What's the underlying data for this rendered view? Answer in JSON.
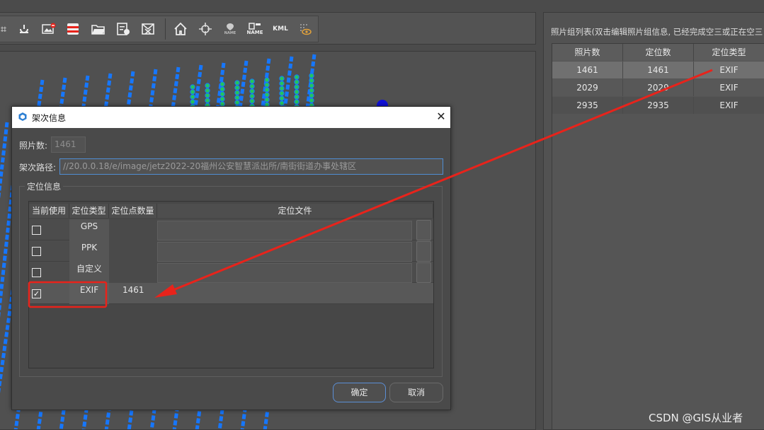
{
  "toolbar": {
    "icons": [
      "crop-icon",
      "stamp-icon",
      "image-remove-icon",
      "record-icon",
      "open-folder-icon",
      "report-icon",
      "mail-close-icon",
      "home-icon",
      "target-icon",
      "name-marker-icon",
      "name-tag-icon",
      "kml-icon",
      "visibility-icon"
    ],
    "name_text": "NAME",
    "name_text2": "NAME",
    "kml_text": "KML"
  },
  "right_panel": {
    "title": "照片组列表(双击编辑照片组信息, 已经完成空三或正在空三",
    "columns": [
      "照片数",
      "定位数",
      "定位类型"
    ],
    "rows": [
      [
        "1461",
        "1461",
        "EXIF"
      ],
      [
        "2029",
        "2029",
        "EXIF"
      ],
      [
        "2935",
        "2935",
        "EXIF"
      ]
    ],
    "selected_row": 0
  },
  "dialog": {
    "title": "架次信息",
    "photo_count_label": "照片数:",
    "photo_count_value": "1461",
    "path_label": "架次路径:",
    "path_value": "//20.0.0.18/e/image/jetz2022-20福州公安智慧派出所/南街街道办事处辖区",
    "group_label": "定位信息",
    "columns": [
      "当前使用",
      "定位类型",
      "定位点数量",
      "定位文件"
    ],
    "rows": [
      {
        "checked": false,
        "type": "GPS",
        "count": ""
      },
      {
        "checked": false,
        "type": "PPK",
        "count": ""
      },
      {
        "checked": false,
        "type": "自定义",
        "count": ""
      },
      {
        "checked": true,
        "type": "EXIF",
        "count": "1461"
      }
    ],
    "ok_label": "确定",
    "cancel_label": "取消"
  },
  "colors": {
    "annotation_red": "#e8231b",
    "point_blue": "#1677ff",
    "point_green": "#22c55e",
    "ok_border": "#5b8fd6"
  },
  "watermark": "CSDN @GIS从业者"
}
